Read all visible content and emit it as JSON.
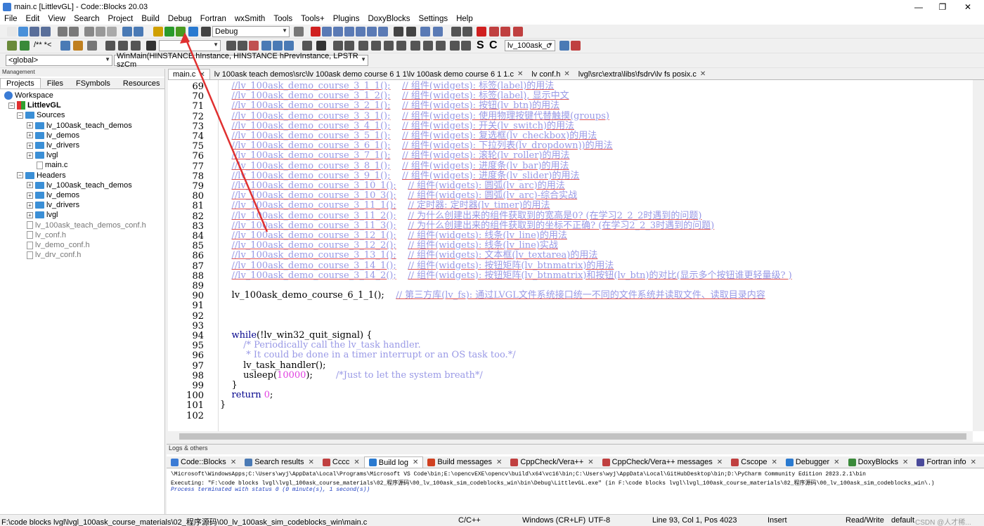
{
  "window": {
    "title": "main.c [LittlevGL] - Code::Blocks 20.03"
  },
  "menu": [
    "File",
    "Edit",
    "View",
    "Search",
    "Project",
    "Build",
    "Debug",
    "Fortran",
    "wxSmith",
    "Tools",
    "Tools+",
    "Plugins",
    "DoxyBlocks",
    "Settings",
    "Help"
  ],
  "toolbar": {
    "build_target": "Debug",
    "scope": "<global>",
    "function": "WinMain(HINSTANCE hInstance, HINSTANCE hPrevInstance, LPSTR szCm",
    "symbol_combo": "lv_100ask_c",
    "comment_btn": "/** *<",
    "bold_s": "S",
    "bold_c": "C"
  },
  "management": {
    "header": "Management",
    "tabs": [
      "Projects",
      "Files",
      "FSymbols",
      "Resources"
    ],
    "tree": [
      {
        "label": "Workspace",
        "level": 0,
        "kind": "workspace"
      },
      {
        "label": "LittlevGL",
        "level": 1,
        "kind": "project"
      },
      {
        "label": "Sources",
        "level": 2,
        "kind": "folder"
      },
      {
        "label": "lv_100ask_teach_demos",
        "level": 3,
        "kind": "folder"
      },
      {
        "label": "lv_demos",
        "level": 3,
        "kind": "folder"
      },
      {
        "label": "lv_drivers",
        "level": 3,
        "kind": "folder"
      },
      {
        "label": "lvgl",
        "level": 3,
        "kind": "folder"
      },
      {
        "label": "main.c",
        "level": 4,
        "kind": "file"
      },
      {
        "label": "Headers",
        "level": 2,
        "kind": "folder"
      },
      {
        "label": "lv_100ask_teach_demos",
        "level": 3,
        "kind": "folder"
      },
      {
        "label": "lv_demos",
        "level": 3,
        "kind": "folder"
      },
      {
        "label": "lv_drivers",
        "level": 3,
        "kind": "folder"
      },
      {
        "label": "lvgl",
        "level": 3,
        "kind": "folder"
      },
      {
        "label": "lv_100ask_teach_demos_conf.h",
        "level": 3,
        "kind": "hfile"
      },
      {
        "label": "lv_conf.h",
        "level": 3,
        "kind": "hfile"
      },
      {
        "label": "lv_demo_conf.h",
        "level": 3,
        "kind": "hfile"
      },
      {
        "label": "lv_drv_conf.h",
        "level": 3,
        "kind": "hfile"
      }
    ]
  },
  "editor": {
    "tabs": [
      "main.c",
      "lv 100ask teach demos\\src\\lv 100ask demo course 6 1 1\\lv 100ask demo course 6 1 1.c",
      "lv conf.h",
      "lvgl\\src\\extra\\libs\\fsdrv\\lv fs posix.c"
    ],
    "line_numbers": [
      "69",
      "70",
      "71",
      "72",
      "73",
      "74",
      "75",
      "76",
      "77",
      "78",
      "79",
      "80",
      "81",
      "82",
      "83",
      "84",
      "85",
      "86",
      "87",
      "88",
      "89",
      "90",
      "91",
      "92",
      "93",
      "94",
      "95",
      "96",
      "97",
      "98",
      "99",
      "100",
      "101",
      "102"
    ],
    "comment_rows": [
      {
        "call": "//lv_100ask_demo_course_3_1_1();",
        "note": "// 组件(widgets): 标签(label)的用法"
      },
      {
        "call": "//lv_100ask_demo_course_3_1_2();",
        "note": "// 组件(widgets): 标签(label), 显示中文"
      },
      {
        "call": "//lv_100ask_demo_course_3_2_1();",
        "note": "// 组件(widgets): 按钮(lv_btn)的用法"
      },
      {
        "call": "//lv_100ask_demo_course_3_3_1();",
        "note": "// 组件(widgets): 使用物理按键代替触摸(groups)"
      },
      {
        "call": "//lv_100ask_demo_course_3_4_1();",
        "note": "// 组件(widgets): 开关(lv_switch)的用法"
      },
      {
        "call": "//lv_100ask_demo_course_3_5_1();",
        "note": "// 组件(widgets): 复选框(lv_checkbox)的用法"
      },
      {
        "call": "//lv_100ask_demo_course_3_6_1();",
        "note": "// 组件(widgets): 下拉列表(lv_dropdown))的用法"
      },
      {
        "call": "//lv_100ask_demo_course_3_7_1();",
        "note": "// 组件(widgets): 滚轮(lv_roller)的用法"
      },
      {
        "call": "//lv_100ask_demo_course_3_8_1();",
        "note": "// 组件(widgets): 进度条(lv_bar)的用法"
      },
      {
        "call": "//lv_100ask_demo_course_3_9_1();",
        "note": "// 组件(widgets): 进度条(lv_slider)的用法"
      },
      {
        "call": "//lv_100ask_demo_course_3_10_1();",
        "note": "// 组件(widgets): 圆弧(lv_arc)的用法"
      },
      {
        "call": "//lv_100ask_demo_course_3_10_3();",
        "note": "// 组件(widgets): 圆弧(lv_arc)-综合实战"
      },
      {
        "call": "//lv_100ask_demo_course_3_11_1();",
        "note": "// 定时器: 定时器(lv_timer)的用法"
      },
      {
        "call": "//lv_100ask_demo_course_3_11_2();",
        "note": "// 为什么创建出来的组件获取到的宽高是0? (在学习2_2_2时遇到的问题)"
      },
      {
        "call": "//lv_100ask_demo_course_3_11_3();",
        "note": "// 为什么创建出来的组件获取到的坐标不正确? (在学习2_2_3时遇到的问题)"
      },
      {
        "call": "//lv_100ask_demo_course_3_12_1();",
        "note": "// 组件(widgets): 线条(lv_line)的用法"
      },
      {
        "call": "//lv_100ask_demo_course_3_12_2();",
        "note": "// 组件(widgets): 线条(lv_line)实战"
      },
      {
        "call": "//lv_100ask_demo_course_3_13_1();",
        "note": "// 组件(widgets): 文本框(lv_textarea)的用法"
      },
      {
        "call": "//lv_100ask_demo_course_3_14_1();",
        "note": "// 组件(widgets): 按钮矩阵(lv_btnmatrix)的用法"
      },
      {
        "call": "//lv_100ask_demo_course_3_14_2();",
        "note": "// 组件(widgets): 按钮矩阵(lv_btnmatrix)和按钮(lv_btn)的对比(显示多个按钮谁更轻量级? )"
      }
    ],
    "line90_call": "lv_100ask_demo_course_6_1_1();",
    "line90_note": "// 第三方库(lv_fs): 通过LVGL文件系统接口统一不同的文件系统并读取文件、读取目录内容",
    "line94_kw": "while",
    "line94_rest": "(!lv_win32_quit_signal) {",
    "line95": "/* Periodically call the lv_task handler.",
    "line96": " * It could be done in a timer interrupt or an OS task too.*/",
    "line97": "lv_task_handler();",
    "line98_fn": "usleep(",
    "line98_num": "10000",
    "line98_end": ");",
    "line98_cm": "/*Just to let the system breath*/",
    "line99": "}",
    "line100_kw": "return",
    "line100_num": "0",
    "line100_end": ";",
    "line101": "}"
  },
  "logs": {
    "header": "Logs & others",
    "tabs": [
      "Code::Blocks",
      "Search results",
      "Cccc",
      "Build log",
      "Build messages",
      "CppCheck/Vera++",
      "CppCheck/Vera++ messages",
      "Cscope",
      "Debugger",
      "DoxyBlocks",
      "Fortran info"
    ],
    "lines": [
      "\\Microsoft\\WindowsApps;C:\\Users\\wyj\\AppData\\Local\\Programs\\Microsoft VS Code\\bin;E:\\opencvEXE\\opencv\\build\\x64\\vc16\\bin;C:\\Users\\wyj\\AppData\\Local\\GitHubDesktop\\bin;D:\\PyCharm Community Edition 2023.2.1\\bin",
      "Executing: \"F:\\code blocks lvgl\\lvgl_100ask_course_materials\\02_程序源码\\00_lv_100ask_sim_codeblocks_win\\bin\\Debug\\LittlevGL.exe\"  (in F:\\code blocks lvgl\\lvgl_100ask_course_materials\\02_程序源码\\00_lv_100ask_sim_codeblocks_win\\.)",
      "Process terminated with status 0 (0 minute(s), 1 second(s))"
    ]
  },
  "status": {
    "path": "F:\\code blocks lvgl\\lvgl_100ask_course_materials\\02_程序源码\\00_lv_100ask_sim_codeblocks_win\\main.c",
    "lang": "C/C++",
    "eol": "Windows (CR+LF)",
    "enc": "UTF-8",
    "pos": "Line 93, Col 1, Pos 4023",
    "mode": "Insert",
    "rw": "Read/Write",
    "profile": "default",
    "watermark": "CSDN @人才稀..."
  },
  "colors": {
    "comment": "#9999e6",
    "keyword": "#00008b",
    "number": "#e040e0",
    "arrow": "#e03030"
  }
}
